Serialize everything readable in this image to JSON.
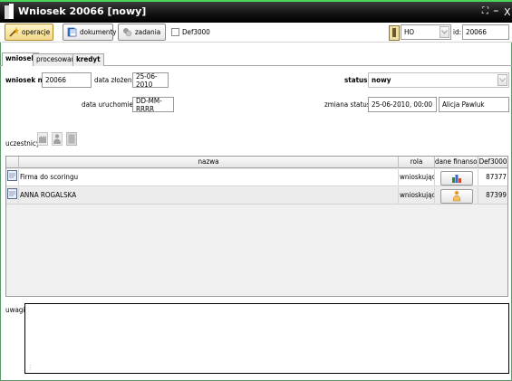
{
  "window": {
    "title": "Wniosek 20066 [nowy]",
    "restore_glyph": "⛶",
    "minimize_glyph": "▬",
    "close_glyph": "X"
  },
  "toolbar": {
    "operacje_label": "operacje",
    "dokumenty_label": "dokumenty",
    "zadania_label": "zadania",
    "def3000_label": "Def3000",
    "def3000_checked": false,
    "branch_value": "HO",
    "id_label": "id:",
    "id_value": "20066"
  },
  "tabs": [
    {
      "label": "wniosek",
      "active": true
    },
    {
      "label": "procesowanie",
      "active": false
    },
    {
      "label": "kredyt",
      "active": false
    }
  ],
  "form": {
    "wniosek_nr_label": "wniosek nr:",
    "wniosek_nr_value": "20066",
    "data_zlozenia_label": "data złożenia:",
    "data_zlozenia_value": "25-06-2010",
    "status_label": "status:",
    "status_value": "nowy",
    "data_uruchomienia_label": "data uruchomienia:",
    "data_uruchomienia_value": "DD-MM-RRRR",
    "zmiana_statusu_label": "zmiana statusu:",
    "zmiana_statusu_value": "25-06-2010, 00:00",
    "zmiana_statusu_user": "Alicja Pawluk",
    "uczestnicy_label": "uczestnicy:"
  },
  "participants_table": {
    "columns": [
      "nazwa",
      "rola",
      "dane finanso...",
      "Def3000"
    ],
    "rows": [
      {
        "nazwa": "Firma do scoringu",
        "rola": "wnioskujący",
        "fin_icon": "company-finance-icon",
        "def3000": "87377"
      },
      {
        "nazwa": "ANNA ROGALSKA",
        "rola": "wnioskujący",
        "fin_icon": "person-finance-icon",
        "def3000": "87399"
      }
    ]
  },
  "uwagi": {
    "label": "uwagi:",
    "value": ""
  },
  "colors": {
    "title_bar": "#000000",
    "title_accent": "#4cd35a",
    "active_button": "#f3d88a"
  }
}
